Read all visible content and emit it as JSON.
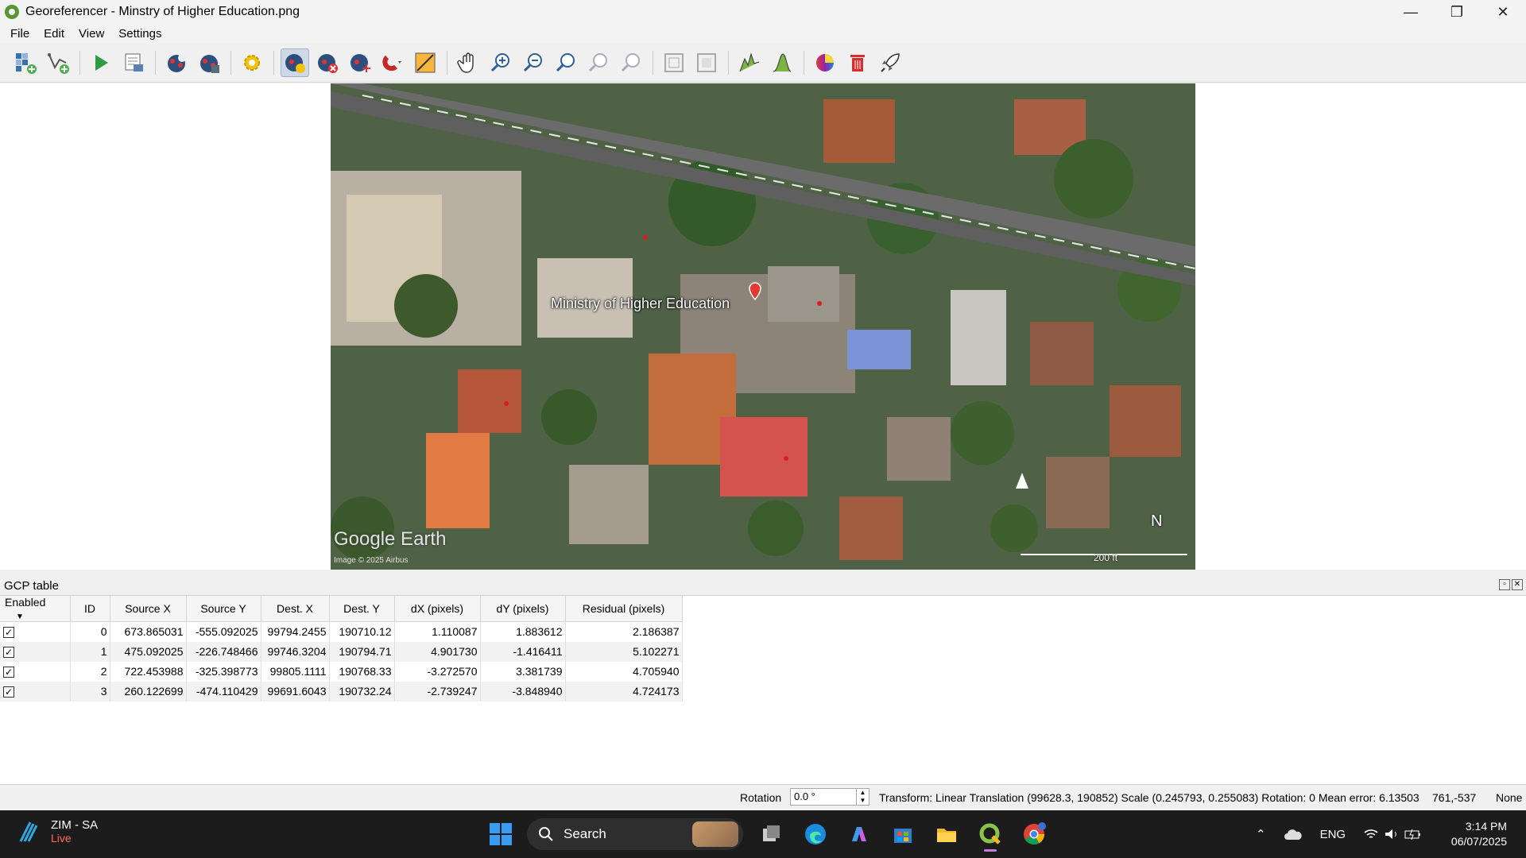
{
  "window": {
    "title": "Georeferencer - Minstry of Higher Education.png",
    "minimize": "—",
    "restore": "❐",
    "close": "✕"
  },
  "menu": {
    "items": [
      "File",
      "Edit",
      "View",
      "Settings"
    ]
  },
  "toolbar": {
    "icons": [
      "open-raster-icon",
      "start-georeferencing-icon",
      "generate-gdal-script-icon",
      "load-gcp-points-icon",
      "save-gcp-points-icon",
      "transformation-settings-icon",
      "add-point-icon",
      "delete-point-icon",
      "move-gcp-point-icon",
      "snap-icon",
      "full-histogram-stretch-icon",
      "pan-icon",
      "zoom-in-icon",
      "zoom-out-icon",
      "zoom-to-layer-icon",
      "zoom-last-icon",
      "zoom-next-icon",
      "link-georeferencer-to-qgis-icon",
      "link-qgis-to-georeferencer-icon",
      "color-icon",
      "delete-icon",
      "rocket-icon"
    ]
  },
  "map": {
    "place_label": "Ministry of Higher Education",
    "logo": "Google Earth",
    "credit": "Image © 2025 Airbus",
    "scale": "200 ft",
    "north": "N"
  },
  "gcp": {
    "title": "GCP table",
    "columns": [
      "Enabled",
      "ID",
      "Source X",
      "Source Y",
      "Dest. X",
      "Dest. Y",
      "dX (pixels)",
      "dY (pixels)",
      "Residual (pixels)"
    ],
    "rows": [
      {
        "enabled": "✓",
        "id": "0",
        "source_x": "673.865031",
        "source_y": "-555.092025",
        "dest_x": "99794.2455",
        "dest_y": "190710.12",
        "dx": "1.110087",
        "dy": "1.883612",
        "residual": "2.186387"
      },
      {
        "enabled": "✓",
        "id": "1",
        "source_x": "475.092025",
        "source_y": "-226.748466",
        "dest_x": "99746.3204",
        "dest_y": "190794.71",
        "dx": "4.901730",
        "dy": "-1.416411",
        "residual": "5.102271"
      },
      {
        "enabled": "✓",
        "id": "2",
        "source_x": "722.453988",
        "source_y": "-325.398773",
        "dest_x": "99805.1111",
        "dest_y": "190768.33",
        "dx": "-3.272570",
        "dy": "3.381739",
        "residual": "4.705940"
      },
      {
        "enabled": "✓",
        "id": "3",
        "source_x": "260.122699",
        "source_y": "-474.110429",
        "dest_x": "99691.6043",
        "dest_y": "190732.24",
        "dx": "-2.739247",
        "dy": "-3.848940",
        "residual": "4.724173"
      }
    ]
  },
  "status": {
    "rotation_label": "Rotation",
    "rotation_value": "0.0 °",
    "transform": "Transform: Linear Translation (99628.3, 190852) Scale (0.245793, 0.255083) Rotation: 0 Mean error: 6.13503",
    "coords": "761,-537",
    "crs": "None"
  },
  "taskbar": {
    "weather_title": "ZIM - SA",
    "weather_sub": "Live",
    "search": "Search",
    "lang": "ENG",
    "time": "3:14 PM",
    "date": "06/07/2025"
  }
}
